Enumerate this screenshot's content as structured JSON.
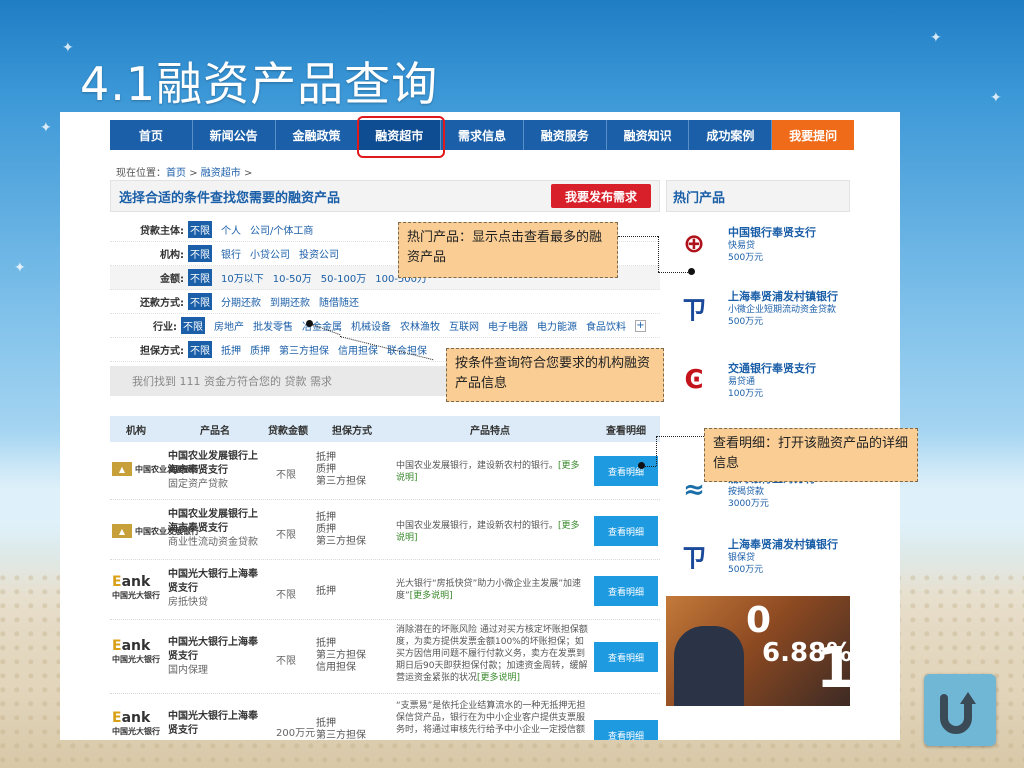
{
  "slide": {
    "title": "4.1融资产品查询"
  },
  "nav": {
    "items": [
      "首页",
      "新闻公告",
      "金融政策",
      "融资超市",
      "需求信息",
      "融资服务",
      "融资知识",
      "成功案例",
      "我要提问"
    ],
    "active_index": 3
  },
  "breadcrumb": {
    "prefix": "现在位置：",
    "home": "首页",
    "current": "融资超市",
    "sep": ">"
  },
  "filter_panel": {
    "title": "选择合适的条件查找您需要的融资产品",
    "publish_label": "我要发布需求",
    "rows": [
      {
        "label": "贷款主体:",
        "options": [
          "不限",
          "个人",
          "公司/个体工商"
        ]
      },
      {
        "label": "机构:",
        "options": [
          "不限",
          "银行",
          "小贷公司",
          "投资公司"
        ]
      },
      {
        "label": "金额:",
        "options": [
          "不限",
          "10万以下",
          "10-50万",
          "50-100万",
          "100-500万"
        ]
      },
      {
        "label": "还款方式:",
        "options": [
          "不限",
          "分期还款",
          "到期还款",
          "随借随还"
        ]
      },
      {
        "label": "行业:",
        "options": [
          "不限",
          "房地产",
          "批发零售",
          "金属",
          "冶金金属",
          "机械设备",
          "农林渔牧",
          "互联网",
          "电子电器",
          "电力能源",
          "食品饮料"
        ]
      },
      {
        "label": "担保方式:",
        "options": [
          "不限",
          "抵押",
          "质押",
          "第三方担保",
          "信用担保",
          "联合担保"
        ]
      }
    ],
    "result_text": "我们找到 111 资金方符合您的 贷款 需求"
  },
  "table": {
    "headers": [
      "机构",
      "产品名",
      "贷款金额",
      "担保方式",
      "产品特点",
      "查看明细"
    ],
    "rows": [
      {
        "logo": "中国农业发展银行",
        "name": "中国农业发展银行上海市奉贤支行",
        "product": "固定资产贷款",
        "amount": "不限",
        "guarantee": [
          "抵押",
          "质押",
          "第三方担保"
        ],
        "desc": "中国农业发展银行，建设新农村的银行。",
        "more": "[更多说明]",
        "button": "查看明细"
      },
      {
        "logo": "中国农业发展银行",
        "name": "中国农业发展银行上海市奉贤支行",
        "product": "商业性流动资金贷款",
        "amount": "不限",
        "guarantee": [
          "抵押",
          "质押",
          "第三方担保"
        ],
        "desc": "中国农业发展银行，建设新农村的银行。",
        "more": "[更多说明]",
        "button": "查看明细"
      },
      {
        "logo": "中国光大银行",
        "name": "中国光大银行上海奉贤支行",
        "product": "房抵快贷",
        "amount": "不限",
        "guarantee": [
          "抵押"
        ],
        "desc": "光大银行“房抵快贷”助力小微企业主发展”加速度”",
        "more": "[更多说明]",
        "button": "查看明细"
      },
      {
        "logo": "中国光大银行",
        "name": "中国光大银行上海奉贤支行",
        "product": "国内保理",
        "amount": "不限",
        "guarantee": [
          "抵押",
          "第三方担保",
          "信用担保"
        ],
        "desc": "消除潜在的坏账风险 通过对买方核定坏账担保额度，为卖方提供发票金额100%的坏账担保；如买方因信用问题不履行付款义务，卖方在发票到期日后90天即获担保付款；加速资金周转，缓解营运资金紧张的状况",
        "more": "[更多说明]",
        "button": "查看明细"
      },
      {
        "logo": "中国光大银行",
        "name": "中国光大银行上海奉贤支行",
        "product": "",
        "amount": "200万元",
        "guarantee": [
          "抵押",
          "第三方担保"
        ],
        "desc": "“支票易”是依托企业结算流水的一种无抵押无担保信贷产品，银行在为中小企业客户提供支票服务时，将通过审核先行给予中小企业一定授信额",
        "more": "",
        "button": "查看明细"
      }
    ]
  },
  "hot_products": {
    "title": "热门产品",
    "items": [
      {
        "logo": "中国银行",
        "bank": "中国银行奉贤支行",
        "product": "快易贷",
        "amount": "500万元"
      },
      {
        "logo": "浦发银行",
        "bank": "上海奉贤浦发村镇银行",
        "product": "小微企业短期流动资金贷款",
        "amount": "500万元"
      },
      {
        "logo": "交通银行",
        "bank": "交通银行奉贤支行",
        "product": "易贷通",
        "amount": "100万元"
      },
      {
        "logo": "渤海银行",
        "bank": "渤海银行上海分行",
        "product": "按揭贷款",
        "amount": "3000万元"
      },
      {
        "logo": "浦发银行",
        "bank": "上海奉贤浦发村镇银行",
        "product": "银保贷",
        "amount": "500万元"
      }
    ],
    "ad": {
      "big": "0",
      "rate": "6.88%",
      "tail": "1"
    }
  },
  "callouts": {
    "hot": "热门产品：显示点击查看最多的融资产品",
    "filter": "按条件查询符合您要求的机构融资产品信息",
    "detail": "查看明细：打开该融资产品的详细信息"
  },
  "colors": {
    "nav": "#1b5fa8",
    "accent_red": "#d8202a",
    "cta_orange": "#ef6b1a",
    "callout": "#f9cd94",
    "detail_btn": "#1e9be0"
  }
}
